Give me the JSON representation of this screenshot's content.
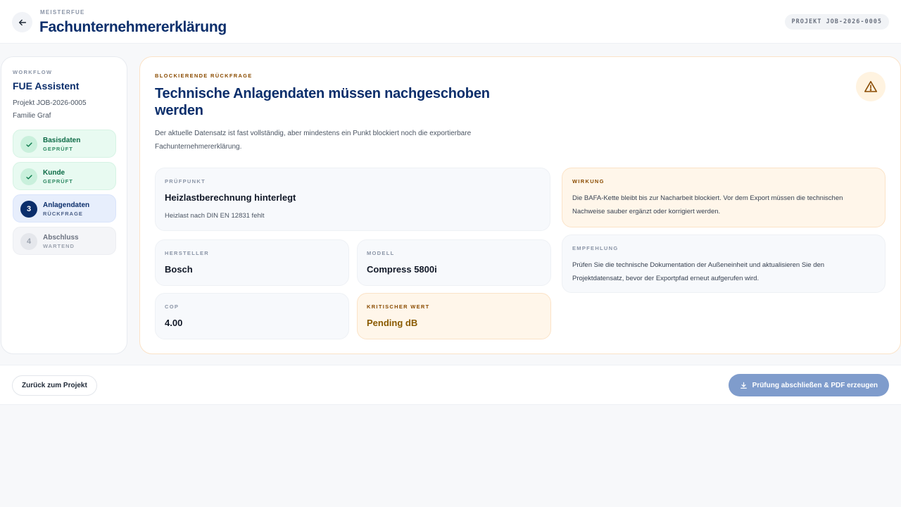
{
  "header": {
    "eyebrow": "MEISTERFUE",
    "title": "Fachunternehmererklärung",
    "project_pill": "PROJEKT JOB-2026-0005"
  },
  "sidebar": {
    "eyebrow": "WORKFLOW",
    "title": "FUE Assistent",
    "project": "Projekt JOB-2026-0005",
    "customer": "Familie Graf",
    "steps": [
      {
        "number": "1",
        "label": "Basisdaten",
        "status": "GEPRÜFT",
        "state": "done"
      },
      {
        "number": "2",
        "label": "Kunde",
        "status": "GEPRÜFT",
        "state": "done"
      },
      {
        "number": "3",
        "label": "Anlagendaten",
        "status": "RÜCKFRAGE",
        "state": "active"
      },
      {
        "number": "4",
        "label": "Abschluss",
        "status": "WARTEND",
        "state": "wait"
      }
    ]
  },
  "main": {
    "eyebrow": "BLOCKIERENDE RÜCKFRAGE",
    "title": "Technische Anlagendaten müssen nachgeschoben werden",
    "description": "Der aktuelle Datensatz ist fast vollständig, aber mindestens ein Punkt blockiert noch die exportierbare Fachunternehmererklärung.",
    "pruefpunkt": {
      "label": "PRÜFPUNKT",
      "value": "Heizlastberechnung hinterlegt",
      "note": "Heizlast nach DIN EN 12831 fehlt"
    },
    "hersteller": {
      "label": "HERSTELLER",
      "value": "Bosch"
    },
    "modell": {
      "label": "MODELL",
      "value": "Compress 5800i"
    },
    "cop": {
      "label": "COP",
      "value": "4.00"
    },
    "kritisch": {
      "label": "KRITISCHER WERT",
      "value": "Pending dB"
    },
    "wirkung": {
      "label": "WIRKUNG",
      "text": "Die BAFA-Kette bleibt bis zur Nacharbeit blockiert. Vor dem Export müssen die technischen Nachweise sauber ergänzt oder korrigiert werden."
    },
    "empfehlung": {
      "label": "EMPFEHLUNG",
      "text": "Prüfen Sie die technische Dokumentation der Außeneinheit und aktualisieren Sie den Projektdatensatz, bevor der Exportpfad erneut aufgerufen wird."
    }
  },
  "footer": {
    "back_label": "Zurück zum Projekt",
    "primary_label": "Prüfung abschließen & PDF erzeugen"
  },
  "icons": {
    "back": "arrow-left-icon",
    "warning": "warning-triangle-icon",
    "check": "check-icon",
    "download": "download-icon"
  },
  "colors": {
    "brand": "#0b2e6b",
    "warning": "#8a4b00",
    "success": "#0b7a4b",
    "primary_button_disabled": "#7f9ccc"
  }
}
